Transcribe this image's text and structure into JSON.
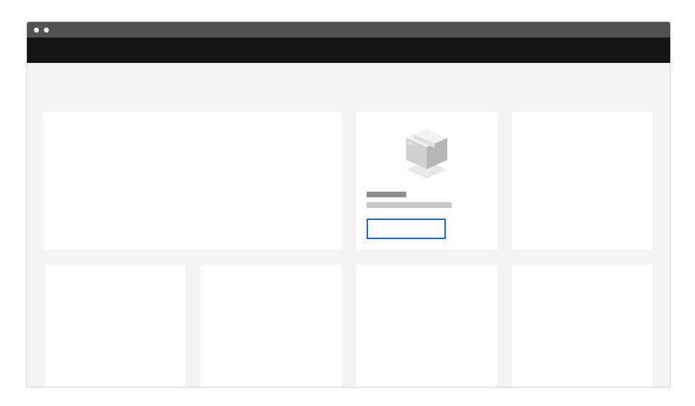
{
  "window": {
    "controls": [
      "window-dot-1",
      "window-dot-2"
    ]
  },
  "product_card": {
    "icon": "package-box-icon",
    "title_placeholder": "",
    "description_placeholder": "",
    "button_label": ""
  },
  "colors": {
    "titlebar": "#525252",
    "navbar": "#161616",
    "page_background": "#f3f3f3",
    "card_background": "#ffffff",
    "button_border": "#0f62fe",
    "title_placeholder": "#8d8d8d",
    "description_placeholder": "#c6c6c6"
  }
}
